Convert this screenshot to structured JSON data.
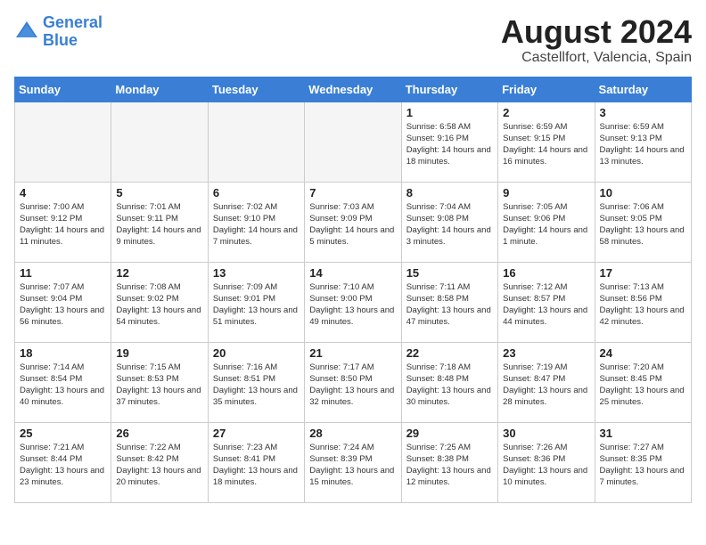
{
  "header": {
    "logo_line1": "General",
    "logo_line2": "Blue",
    "month_year": "August 2024",
    "location": "Castellfort, Valencia, Spain"
  },
  "days_of_week": [
    "Sunday",
    "Monday",
    "Tuesday",
    "Wednesday",
    "Thursday",
    "Friday",
    "Saturday"
  ],
  "weeks": [
    [
      {
        "day": "",
        "info": ""
      },
      {
        "day": "",
        "info": ""
      },
      {
        "day": "",
        "info": ""
      },
      {
        "day": "",
        "info": ""
      },
      {
        "day": "1",
        "info": "Sunrise: 6:58 AM\nSunset: 9:16 PM\nDaylight: 14 hours\nand 18 minutes."
      },
      {
        "day": "2",
        "info": "Sunrise: 6:59 AM\nSunset: 9:15 PM\nDaylight: 14 hours\nand 16 minutes."
      },
      {
        "day": "3",
        "info": "Sunrise: 6:59 AM\nSunset: 9:13 PM\nDaylight: 14 hours\nand 13 minutes."
      }
    ],
    [
      {
        "day": "4",
        "info": "Sunrise: 7:00 AM\nSunset: 9:12 PM\nDaylight: 14 hours\nand 11 minutes."
      },
      {
        "day": "5",
        "info": "Sunrise: 7:01 AM\nSunset: 9:11 PM\nDaylight: 14 hours\nand 9 minutes."
      },
      {
        "day": "6",
        "info": "Sunrise: 7:02 AM\nSunset: 9:10 PM\nDaylight: 14 hours\nand 7 minutes."
      },
      {
        "day": "7",
        "info": "Sunrise: 7:03 AM\nSunset: 9:09 PM\nDaylight: 14 hours\nand 5 minutes."
      },
      {
        "day": "8",
        "info": "Sunrise: 7:04 AM\nSunset: 9:08 PM\nDaylight: 14 hours\nand 3 minutes."
      },
      {
        "day": "9",
        "info": "Sunrise: 7:05 AM\nSunset: 9:06 PM\nDaylight: 14 hours\nand 1 minute."
      },
      {
        "day": "10",
        "info": "Sunrise: 7:06 AM\nSunset: 9:05 PM\nDaylight: 13 hours\nand 58 minutes."
      }
    ],
    [
      {
        "day": "11",
        "info": "Sunrise: 7:07 AM\nSunset: 9:04 PM\nDaylight: 13 hours\nand 56 minutes."
      },
      {
        "day": "12",
        "info": "Sunrise: 7:08 AM\nSunset: 9:02 PM\nDaylight: 13 hours\nand 54 minutes."
      },
      {
        "day": "13",
        "info": "Sunrise: 7:09 AM\nSunset: 9:01 PM\nDaylight: 13 hours\nand 51 minutes."
      },
      {
        "day": "14",
        "info": "Sunrise: 7:10 AM\nSunset: 9:00 PM\nDaylight: 13 hours\nand 49 minutes."
      },
      {
        "day": "15",
        "info": "Sunrise: 7:11 AM\nSunset: 8:58 PM\nDaylight: 13 hours\nand 47 minutes."
      },
      {
        "day": "16",
        "info": "Sunrise: 7:12 AM\nSunset: 8:57 PM\nDaylight: 13 hours\nand 44 minutes."
      },
      {
        "day": "17",
        "info": "Sunrise: 7:13 AM\nSunset: 8:56 PM\nDaylight: 13 hours\nand 42 minutes."
      }
    ],
    [
      {
        "day": "18",
        "info": "Sunrise: 7:14 AM\nSunset: 8:54 PM\nDaylight: 13 hours\nand 40 minutes."
      },
      {
        "day": "19",
        "info": "Sunrise: 7:15 AM\nSunset: 8:53 PM\nDaylight: 13 hours\nand 37 minutes."
      },
      {
        "day": "20",
        "info": "Sunrise: 7:16 AM\nSunset: 8:51 PM\nDaylight: 13 hours\nand 35 minutes."
      },
      {
        "day": "21",
        "info": "Sunrise: 7:17 AM\nSunset: 8:50 PM\nDaylight: 13 hours\nand 32 minutes."
      },
      {
        "day": "22",
        "info": "Sunrise: 7:18 AM\nSunset: 8:48 PM\nDaylight: 13 hours\nand 30 minutes."
      },
      {
        "day": "23",
        "info": "Sunrise: 7:19 AM\nSunset: 8:47 PM\nDaylight: 13 hours\nand 28 minutes."
      },
      {
        "day": "24",
        "info": "Sunrise: 7:20 AM\nSunset: 8:45 PM\nDaylight: 13 hours\nand 25 minutes."
      }
    ],
    [
      {
        "day": "25",
        "info": "Sunrise: 7:21 AM\nSunset: 8:44 PM\nDaylight: 13 hours\nand 23 minutes."
      },
      {
        "day": "26",
        "info": "Sunrise: 7:22 AM\nSunset: 8:42 PM\nDaylight: 13 hours\nand 20 minutes."
      },
      {
        "day": "27",
        "info": "Sunrise: 7:23 AM\nSunset: 8:41 PM\nDaylight: 13 hours\nand 18 minutes."
      },
      {
        "day": "28",
        "info": "Sunrise: 7:24 AM\nSunset: 8:39 PM\nDaylight: 13 hours\nand 15 minutes."
      },
      {
        "day": "29",
        "info": "Sunrise: 7:25 AM\nSunset: 8:38 PM\nDaylight: 13 hours\nand 12 minutes."
      },
      {
        "day": "30",
        "info": "Sunrise: 7:26 AM\nSunset: 8:36 PM\nDaylight: 13 hours\nand 10 minutes."
      },
      {
        "day": "31",
        "info": "Sunrise: 7:27 AM\nSunset: 8:35 PM\nDaylight: 13 hours\nand 7 minutes."
      }
    ]
  ]
}
